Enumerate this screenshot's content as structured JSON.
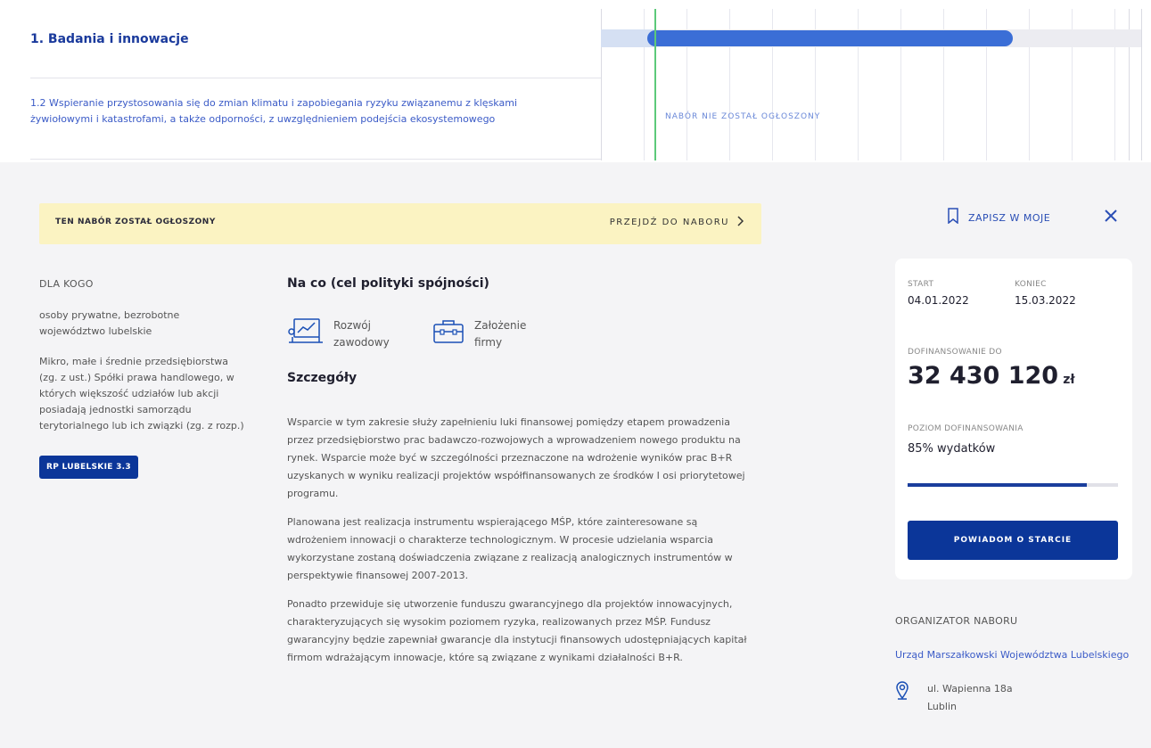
{
  "gantt": {
    "row1_title": "1. Badania i innowacje",
    "row2_title": "1.2 Wspieranie przystosowania się do zmian klimatu i zapobiegania ryzyku związanemu z klęskami żywiołowymi i katastrofami, a także odporności, z uwzględnieniem podejścia ekosystemowego",
    "row2_status": "NABÓR NIE ZOSTAŁ OGŁOSZONY"
  },
  "banner": {
    "text": "TEN NABÓR ZOSTAŁ OGŁOSZONY",
    "link_label": "PRZEJDŹ DO NABORU"
  },
  "actions": {
    "save_label": "ZAPISZ W MOJE"
  },
  "left": {
    "label": "DLA KOGO",
    "target1": "osoby prywatne, bezrobotne województwo lubelskie",
    "target2": "Mikro, małe i średnie przedsiębiorstwa (zg. z ust.) Spółki prawa handlowego, w których większość udziałów lub akcji posiadają jednostki samorządu terytorialnego lub ich związki (zg. z rozp.)",
    "tag": "RP LUBELSKIE 3.3"
  },
  "main": {
    "goal_heading": "Na co (cel polityki spójności)",
    "tiles": [
      {
        "label": "Rozwój zawodowy",
        "icon": "chart-board-icon"
      },
      {
        "label": "Założenie firmy",
        "icon": "briefcase-icon"
      }
    ],
    "details_heading": "Szczegóły",
    "paragraphs": [
      "Wsparcie w tym zakresie służy zapełnieniu luki finansowej pomiędzy etapem prowadzenia przez przedsiębiorstwo prac badawczo-rozwojowych a wprowadzeniem nowego produktu na rynek. Wsparcie może być w szczególności przeznaczone na wdrożenie wyników prac B+R uzyskanych w wyniku realizacji projektów współfinansowanych ze środków I osi priorytetowej programu.",
      "Planowana jest realizacja instrumentu wspierającego MŚP, które zainteresowane są wdrożeniem innowacji o charakterze technologicznym. W procesie udzielania wsparcia wykorzystane zostaną doświadczenia związane z realizacją analogicznych instrumentów w perspektywie finansowej 2007-2013.",
      "Ponadto przewiduje się utworzenie funduszu gwarancyjnego dla projektów innowacyjnych, charakteryzujących się wysokim poziomem ryzyka, realizowanych przez MŚP. Fundusz gwarancyjny będzie zapewniał gwarancje dla instytucji finansowych udostępniających kapitał firmom wdrażającym innowacje, które są związane z wynikami działalności B+R."
    ]
  },
  "card": {
    "start_label": "START",
    "start_date": "04.01.2022",
    "end_label": "KONIEC",
    "end_date": "15.03.2022",
    "funding_label": "DOFINANSOWANIE DO",
    "amount": "32 430 120",
    "currency": "zł",
    "level_label": "POZIOM DOFINANSOWANIA",
    "level_value": "85% wydatków",
    "level_fraction": 0.85,
    "notify_label": "POWIADOM O STARCIE"
  },
  "organizer": {
    "label": "ORGANIZATOR NABORU",
    "name": "Urząd Marszałkowski Województwa Lubelskiego",
    "street": "ul. Wapienna 18a",
    "city": "Lublin"
  },
  "colors": {
    "accent": "#0b3699",
    "bar": "#3b6ed6",
    "today": "#5cc97a",
    "banner": "#fbf3c2"
  }
}
